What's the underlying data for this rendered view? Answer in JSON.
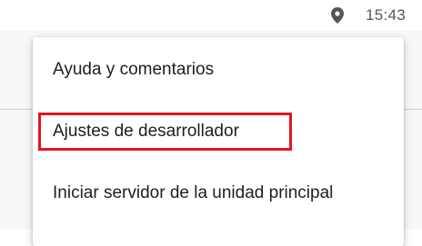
{
  "status_bar": {
    "time": "15:43",
    "icons": [
      "location-pin-icon"
    ]
  },
  "menu": {
    "items": [
      {
        "label": "Ayuda y comentarios"
      },
      {
        "label": "Ajustes de desarrollador",
        "highlighted": true
      },
      {
        "label": "Iniciar servidor de la unidad principal"
      }
    ]
  },
  "colors": {
    "highlight": "#e5131f",
    "text": "#202020",
    "status_text": "#555555"
  }
}
